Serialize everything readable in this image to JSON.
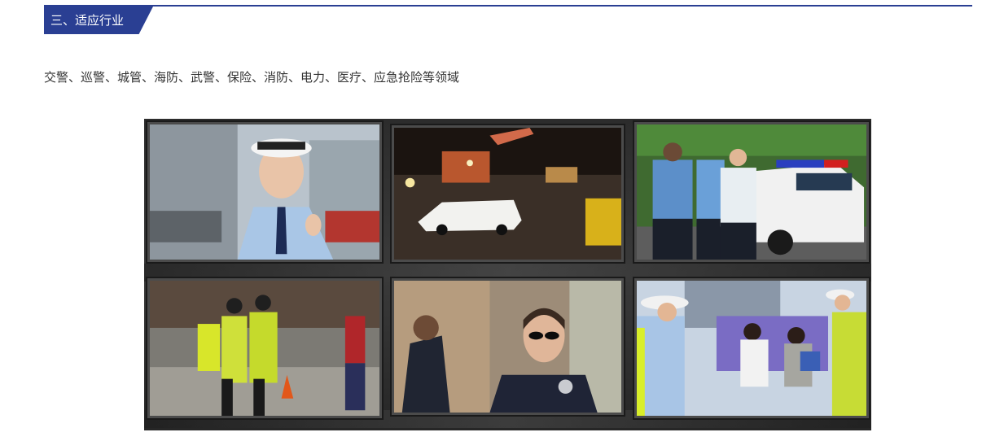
{
  "section": {
    "tag_label": "三、适应行业"
  },
  "description": "交警、巡警、城管、海防、武警、保险、消防、电力、医疗、应急抢险等领域",
  "colors": {
    "accent": "#2a3f93",
    "text": "#333333"
  },
  "video_wall": {
    "screens": [
      {
        "name": "traffic-police-woman-screen"
      },
      {
        "name": "night-accident-scene-screen"
      },
      {
        "name": "police-officers-car-screen"
      },
      {
        "name": "street-patrol-officers-screen"
      },
      {
        "name": "security-guard-sunglasses-screen"
      },
      {
        "name": "traffic-police-public-event-screen"
      }
    ]
  }
}
